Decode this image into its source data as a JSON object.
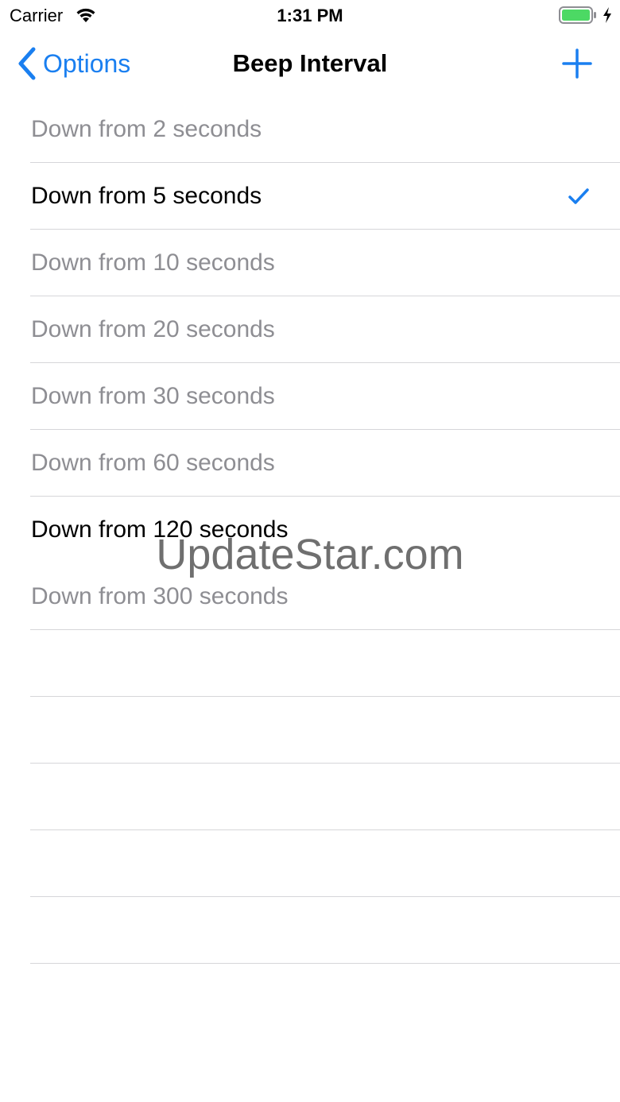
{
  "status_bar": {
    "carrier": "Carrier",
    "time": "1:31 PM",
    "battery_color": "#4cd964",
    "icons": [
      "wifi-icon",
      "battery-icon",
      "charging-bolt-icon"
    ]
  },
  "nav_bar": {
    "back_label": "Options",
    "title": "Beep Interval",
    "add_icon": "plus-icon",
    "accent_color": "#1a7ff0"
  },
  "intervals": [
    {
      "label": "Down from 2 seconds",
      "enabled": false,
      "selected": false
    },
    {
      "label": "Down from 5 seconds",
      "enabled": true,
      "selected": true
    },
    {
      "label": "Down from 10 seconds",
      "enabled": false,
      "selected": false
    },
    {
      "label": "Down from 20 seconds",
      "enabled": false,
      "selected": false
    },
    {
      "label": "Down from 30 seconds",
      "enabled": false,
      "selected": false
    },
    {
      "label": "Down from 60 seconds",
      "enabled": false,
      "selected": false
    },
    {
      "label": "Down from 120 seconds",
      "enabled": true,
      "selected": false
    },
    {
      "label": "Down from 300 seconds",
      "enabled": false,
      "selected": false
    }
  ],
  "watermark": "UpdateStar.com"
}
